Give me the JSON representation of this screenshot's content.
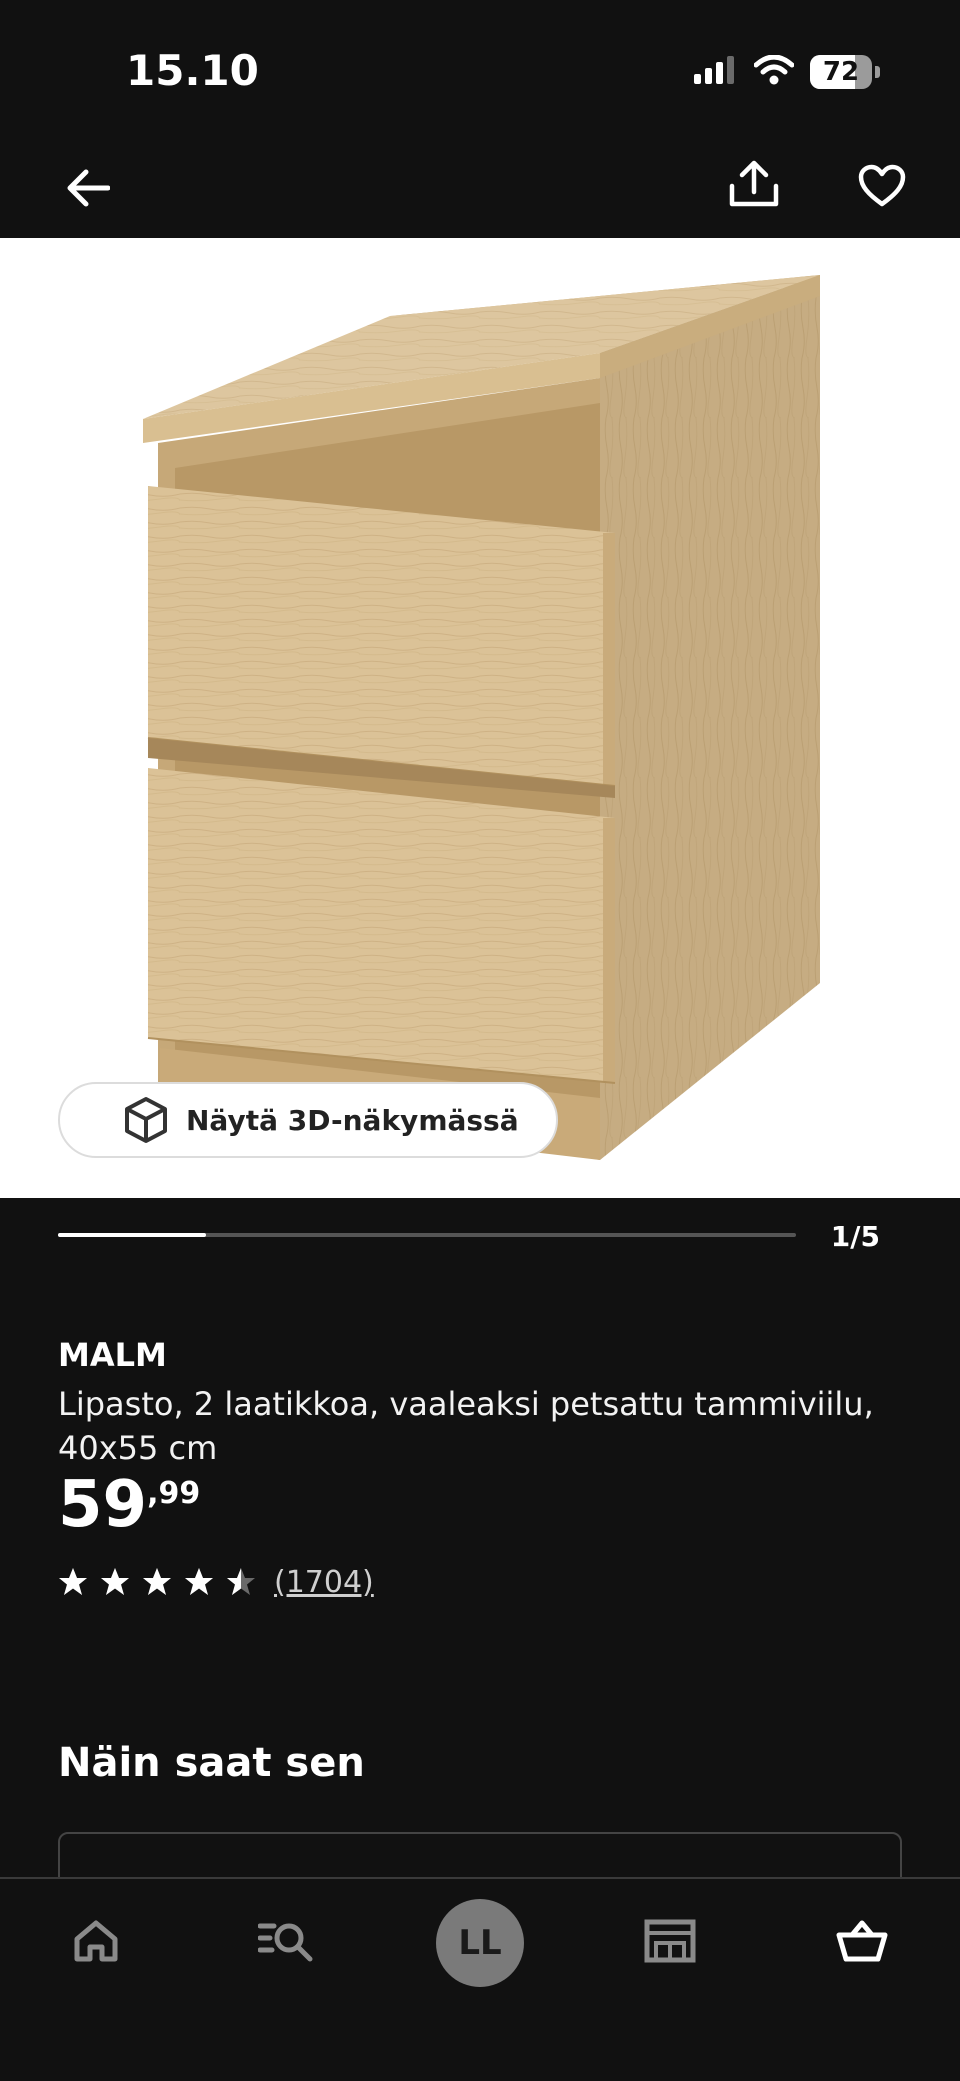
{
  "status_bar": {
    "time": "15.10",
    "battery": "72",
    "battery_level": 0.72,
    "icons": [
      "cellular-signal-icon",
      "wifi-icon",
      "battery-icon"
    ]
  },
  "top_nav": {
    "icons": [
      "back-arrow-icon",
      "share-icon",
      "heart-icon"
    ]
  },
  "gallery": {
    "view_3d_label": "Näytä 3D-näkymässä",
    "counter": "1/5",
    "current_image": 1,
    "total_images": 5
  },
  "product": {
    "name": "MALM",
    "description": "Lipasto, 2 laatikkoa, vaaleaksi petsattu tammiviilu, 40x55 cm",
    "price_main": "59",
    "price_decimals": ",99",
    "rating": 4.5,
    "rating_max": 5,
    "review_count": "(1704)"
  },
  "delivery": {
    "title": "Näin saat sen"
  },
  "bottom_nav": {
    "profile_initials": "LL",
    "icons": [
      "home-icon",
      "search-list-icon",
      "profile-avatar",
      "store-icon",
      "basket-icon"
    ]
  },
  "colors": {
    "background": "#111111",
    "image_background": "#ffffff",
    "wood": "#d8bc8e",
    "text": "#ffffff",
    "muted": "#cfcfcf"
  }
}
